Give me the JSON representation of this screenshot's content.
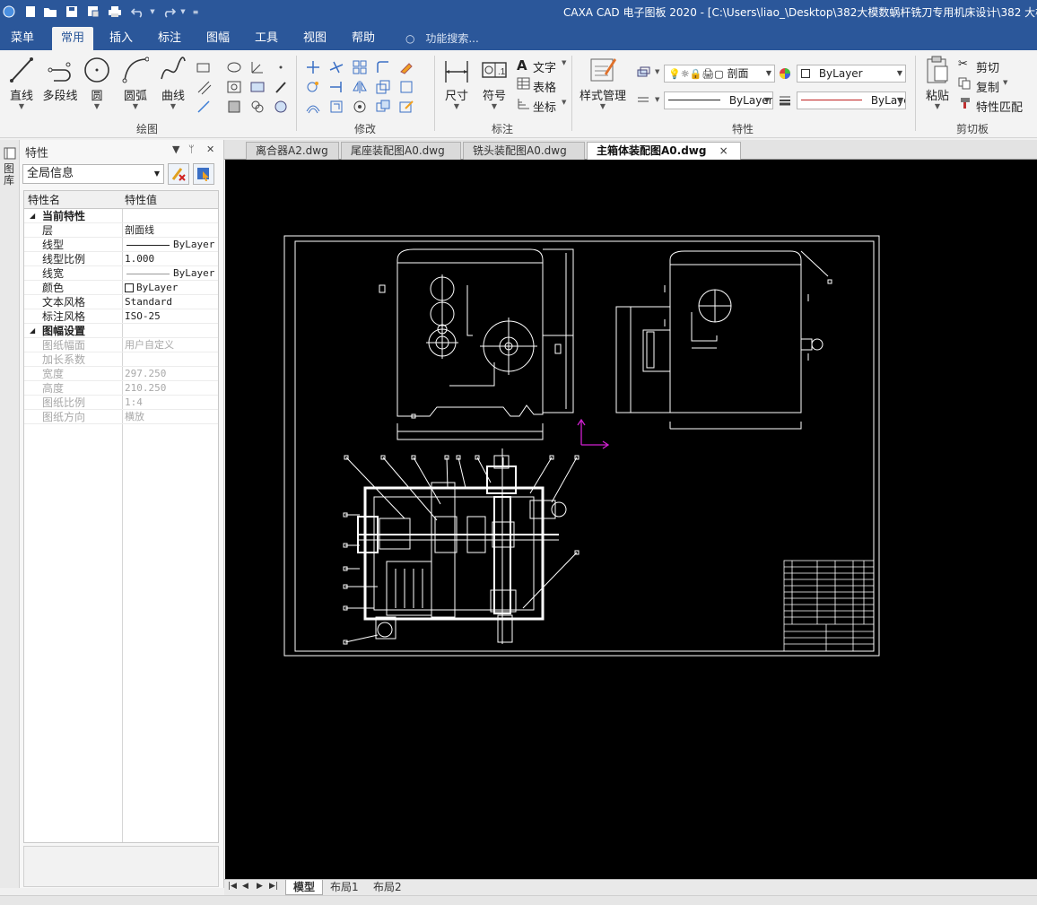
{
  "window": {
    "title": "CAXA CAD 电子图板 2020 - [C:\\Users\\liao_\\Desktop\\382大模数蜗杆铣刀专用机床设计\\382 大模"
  },
  "menu": {
    "tabs": [
      "菜单",
      "常用",
      "插入",
      "标注",
      "图幅",
      "工具",
      "视图",
      "帮助"
    ],
    "active": "常用",
    "search_placeholder": "功能搜索..."
  },
  "ribbon": {
    "draw": {
      "label": "绘图",
      "line": "直线",
      "polyline": "多段线",
      "circle": "圆",
      "arc": "圆弧",
      "curve": "曲线"
    },
    "modify": {
      "label": "修改"
    },
    "annotate": {
      "label": "标注",
      "dimension": "尺寸",
      "symbol": "符号",
      "text": "文字",
      "table": "表格",
      "coordinate": "坐标"
    },
    "properties": {
      "label": "特性",
      "style_manager": "样式管理",
      "layer_value": "剖面",
      "color_value": "ByLayer",
      "linetype_value": "ByLayer",
      "lineweight_value": "ByLaye"
    },
    "clipboard": {
      "label": "剪切板",
      "paste": "粘贴",
      "cut": "剪切",
      "copy": "复制",
      "match": "特性匹配"
    }
  },
  "panel": {
    "title": "特性",
    "side_tab": "图库",
    "filter_value": "全局信息",
    "col_name": "特性名",
    "col_value": "特性值",
    "sections": [
      {
        "name": "当前特性",
        "rows": [
          {
            "k": "层",
            "v": "剖面线"
          },
          {
            "k": "线型",
            "v": "ByLayer"
          },
          {
            "k": "线型比例",
            "v": "1.000"
          },
          {
            "k": "线宽",
            "v": "ByLayer"
          },
          {
            "k": "颜色",
            "v": "ByLayer"
          },
          {
            "k": "文本风格",
            "v": "Standard"
          },
          {
            "k": "标注风格",
            "v": "ISO-25"
          }
        ]
      },
      {
        "name": "图幅设置",
        "rows": [
          {
            "k": "图纸幅面",
            "v": "用户自定义"
          },
          {
            "k": "加长系数",
            "v": ""
          },
          {
            "k": "宽度",
            "v": "297.250"
          },
          {
            "k": "高度",
            "v": "210.250"
          },
          {
            "k": "图纸比例",
            "v": "1:4"
          },
          {
            "k": "图纸方向",
            "v": "横放"
          }
        ]
      }
    ]
  },
  "doc_tabs": [
    "离合器A2.dwg",
    "尾座装配图A0.dwg",
    "铣头装配图A0.dwg",
    "主箱体装配图A0.dwg"
  ],
  "doc_tab_close": "×",
  "layout_tabs": [
    "模型",
    "布局1",
    "布局2"
  ],
  "colors": {
    "accent": "#2b579a",
    "canvas": "#000000",
    "ucs": "#d020d0"
  }
}
